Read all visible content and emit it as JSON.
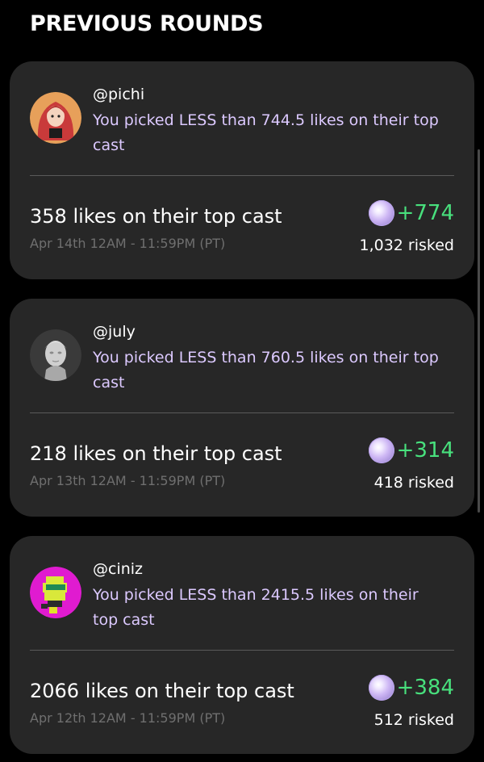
{
  "header": {
    "title": "PREVIOUS ROUNDS"
  },
  "rounds": [
    {
      "handle": "@pichi",
      "pick": "You picked LESS than 744.5 likes on their top cast",
      "result": "358 likes on their top cast",
      "date": "Apr 14th 12AM - 11:59PM (PT)",
      "gain": "+774",
      "risked": "1,032 risked"
    },
    {
      "handle": "@july",
      "pick": "You picked LESS than 760.5 likes on their top cast",
      "result": "218 likes on their top cast",
      "date": "Apr 13th 12AM - 11:59PM (PT)",
      "gain": "+314",
      "risked": "418 risked"
    },
    {
      "handle": "@ciniz",
      "pick": "You picked LESS than 2415.5 likes on their top cast",
      "result": "2066 likes on their top cast",
      "date": "Apr 12th 12AM - 11:59PM (PT)",
      "gain": "+384",
      "risked": "512 risked"
    }
  ],
  "icons": {
    "points": "purple-orb-icon"
  },
  "colors": {
    "background": "#000000",
    "card": "#272727",
    "pick_text": "#dcc9ff",
    "gain": "#48e07d",
    "date": "#6f6f6f"
  }
}
